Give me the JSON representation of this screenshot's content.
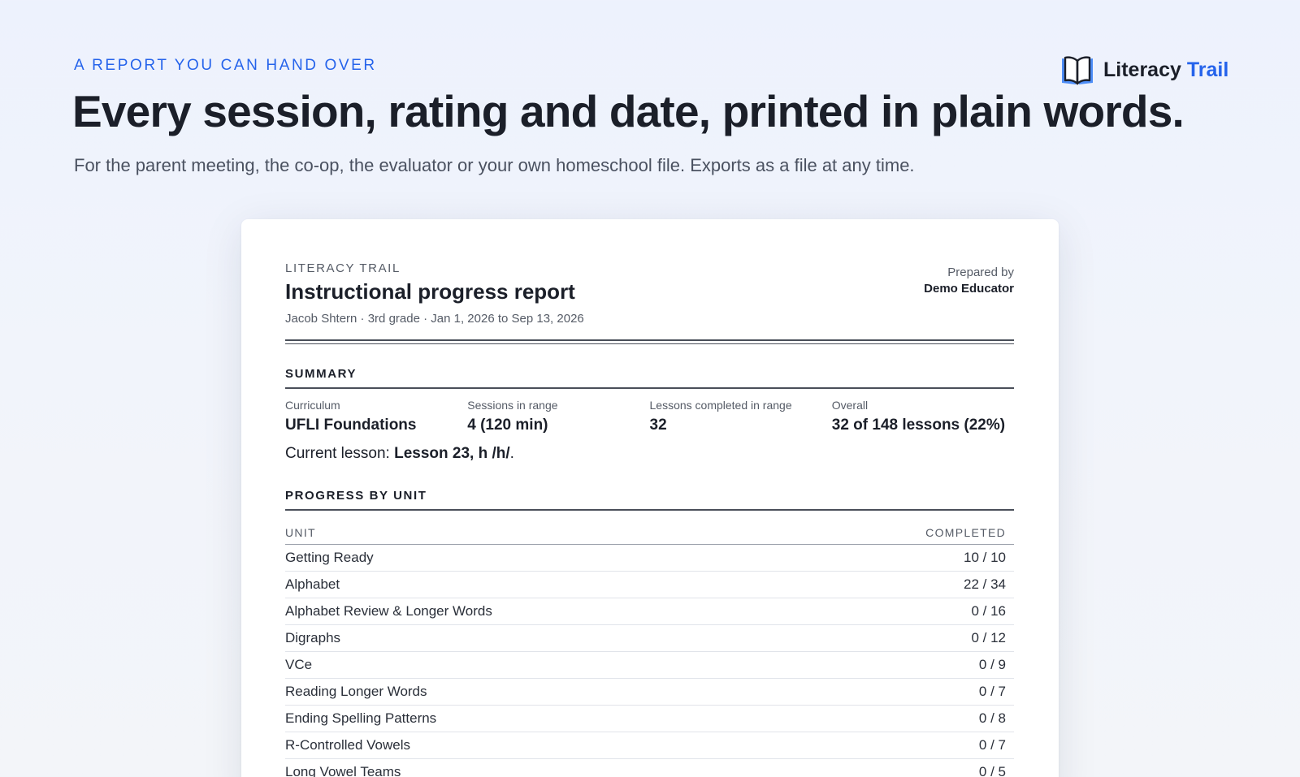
{
  "brand": {
    "name_main": "Literacy",
    "name_accent": "Trail",
    "icon": "open-book-icon",
    "accent_color": "#2563eb"
  },
  "hero": {
    "eyebrow": "A REPORT YOU CAN HAND OVER",
    "headline": "Every session, rating and date, printed in plain words.",
    "subhead": "For the parent meeting, the co-op, the evaluator or your own homeschool file. Exports as a file at any time."
  },
  "report": {
    "brand_label": "LITERACY TRAIL",
    "title": "Instructional progress report",
    "meta": "Jacob Shtern · 3rd grade · Jan 1, 2026 to Sep 13, 2026",
    "prepared_by_label": "Prepared by",
    "prepared_by_name": "Demo Educator",
    "summary": {
      "heading": "SUMMARY",
      "stats": [
        {
          "label": "Curriculum",
          "value": "UFLI Foundations"
        },
        {
          "label": "Sessions in range",
          "value": "4 (120 min)"
        },
        {
          "label": "Lessons completed in range",
          "value": "32"
        },
        {
          "label": "Overall",
          "value": "32 of 148 lessons (22%)"
        }
      ],
      "current_label": "Current lesson:",
      "current_value": "Lesson 23, h /h/",
      "current_suffix": "."
    },
    "units": {
      "heading": "PROGRESS BY UNIT",
      "col_unit": "UNIT",
      "col_completed": "COMPLETED",
      "rows": [
        {
          "unit": "Getting Ready",
          "completed": "10 / 10"
        },
        {
          "unit": "Alphabet",
          "completed": "22 / 34"
        },
        {
          "unit": "Alphabet Review & Longer Words",
          "completed": "0 / 16"
        },
        {
          "unit": "Digraphs",
          "completed": "0 / 12"
        },
        {
          "unit": "VCe",
          "completed": "0 / 9"
        },
        {
          "unit": "Reading Longer Words",
          "completed": "0 / 7"
        },
        {
          "unit": "Ending Spelling Patterns",
          "completed": "0 / 8"
        },
        {
          "unit": "R-Controlled Vowels",
          "completed": "0 / 7"
        },
        {
          "unit": "Long Vowel Teams",
          "completed": "0 / 5"
        }
      ]
    }
  }
}
